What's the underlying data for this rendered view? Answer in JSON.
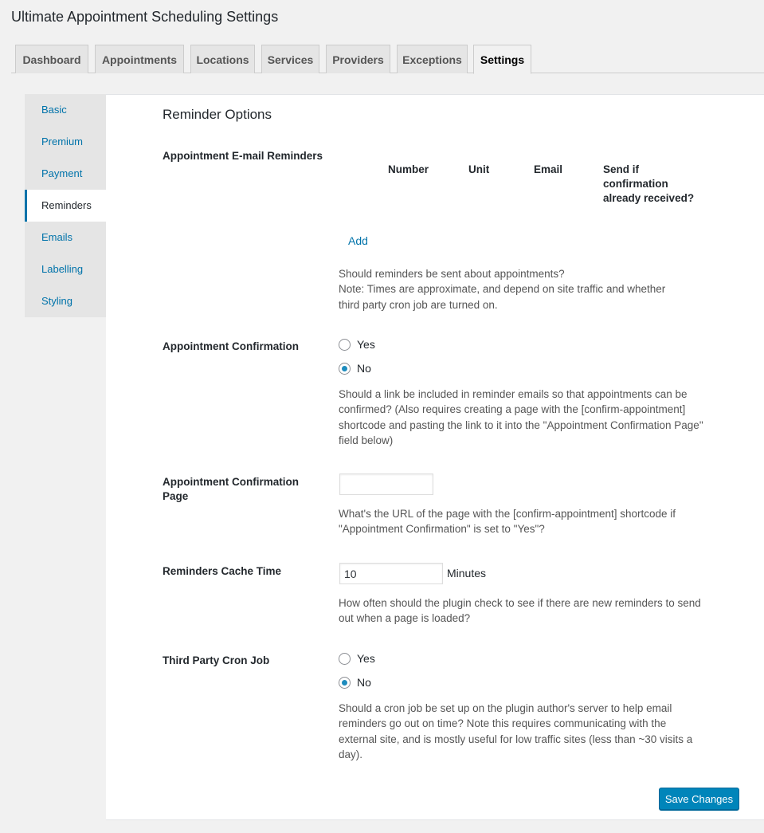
{
  "page": {
    "title": "Ultimate Appointment Scheduling Settings"
  },
  "tabs": [
    {
      "label": "Dashboard"
    },
    {
      "label": "Appointments"
    },
    {
      "label": "Locations"
    },
    {
      "label": "Services"
    },
    {
      "label": "Providers"
    },
    {
      "label": "Exceptions"
    },
    {
      "label": "Settings"
    }
  ],
  "sidebar": {
    "items": [
      {
        "label": "Basic"
      },
      {
        "label": "Premium"
      },
      {
        "label": "Payment"
      },
      {
        "label": "Reminders"
      },
      {
        "label": "Emails"
      },
      {
        "label": "Labelling"
      },
      {
        "label": "Styling"
      }
    ]
  },
  "main": {
    "section_title": "Reminder Options",
    "email_reminders": {
      "label": "Appointment E-mail Reminders",
      "columns": [
        "Number",
        "Unit",
        "Email",
        "Send if confirmation already received?"
      ],
      "add_label": "Add",
      "description": "Should reminders be sent about appointments?\nNote: Times are approximate, and depend on site traffic and whether third party cron job are turned on."
    },
    "confirmation": {
      "label": "Appointment Confirmation",
      "options": [
        "Yes",
        "No"
      ],
      "selected": "No",
      "description": "Should a link be included in reminder emails so that appointments can be confirmed? (Also requires creating a page with the [confirm-appointment] shortcode and pasting the link to it into the \"Appointment Confirmation Page\" field below)"
    },
    "confirmation_page": {
      "label": "Appointment Confirmation Page",
      "value": "",
      "description": "What's the URL of the page with the [confirm-appointment] shortcode if \"Appointment Confirmation\" is set to \"Yes\"?"
    },
    "cache_time": {
      "label": "Reminders Cache Time",
      "value": "10",
      "unit": "Minutes",
      "description": "How often should the plugin check to see if there are new reminders to send out when a page is loaded?"
    },
    "cron_job": {
      "label": "Third Party Cron Job",
      "options": [
        "Yes",
        "No"
      ],
      "selected": "No",
      "description": "Should a cron job be set up on the plugin author's server to help email reminders go out on time? Note this requires communicating with the external site, and is mostly useful for low traffic sites (less than ~30 visits a day)."
    },
    "save_label": "Save Changes"
  },
  "colors": {
    "accent": "#0073aa",
    "button": "#0085ba"
  }
}
